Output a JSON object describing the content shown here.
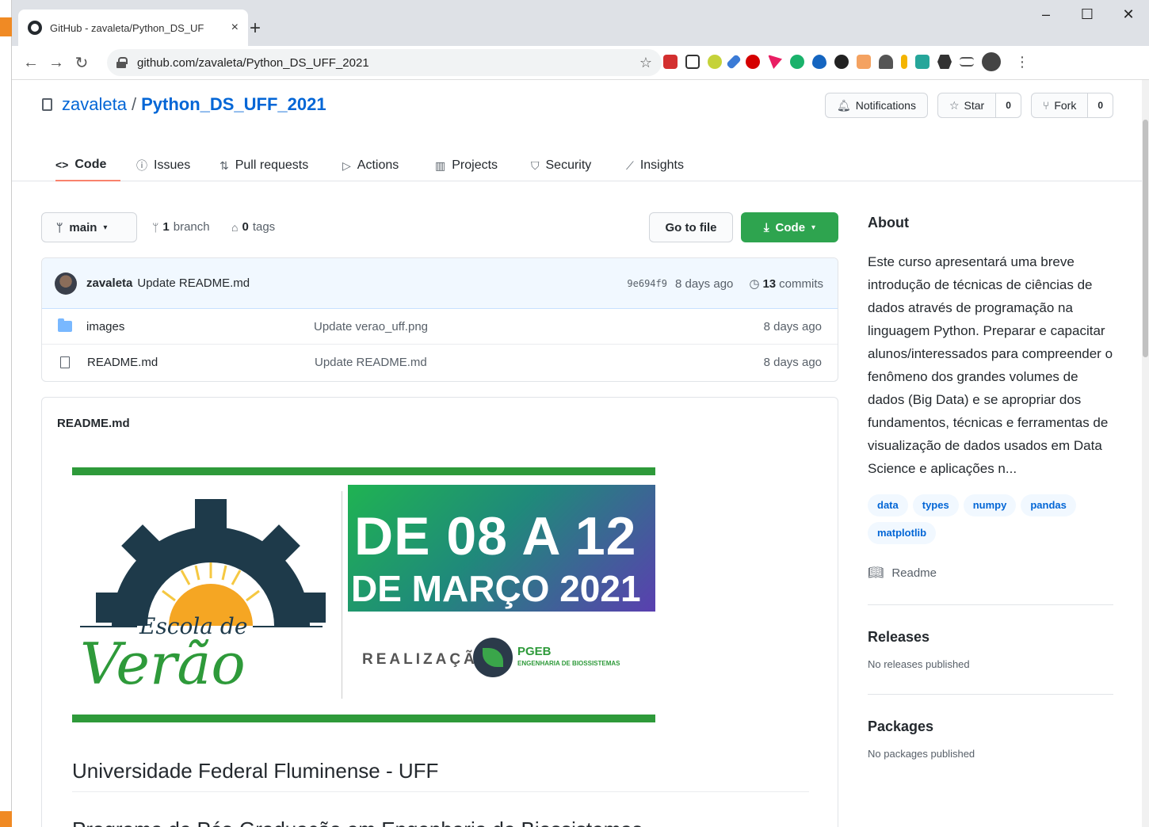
{
  "browser": {
    "tab_title": "GitHub - zavaleta/Python_DS_UF",
    "tab_close": "×",
    "new_tab": "+",
    "url": "github.com/zavaleta/Python_DS_UFF_2021",
    "win_minimize": "–",
    "win_maximize": "☐",
    "win_close": "✕"
  },
  "repo": {
    "owner": "zavaleta",
    "slash": "/",
    "name": "Python_DS_UFF_2021",
    "notifications_label": "Notifications",
    "star_label": "Star",
    "star_count": "0",
    "fork_label": "Fork",
    "fork_count": "0"
  },
  "nav": {
    "tabs": [
      {
        "label": "Code",
        "icon": "<>"
      },
      {
        "label": "Issues",
        "icon": "ⓘ"
      },
      {
        "label": "Pull requests",
        "icon": "⇅"
      },
      {
        "label": "Actions",
        "icon": "▷"
      },
      {
        "label": "Projects",
        "icon": "▥"
      },
      {
        "label": "Security",
        "icon": "⛉"
      },
      {
        "label": "Insights",
        "icon": "⟋"
      }
    ]
  },
  "files_toolbar": {
    "branch": "main",
    "branch_count": "1",
    "branch_word": "branch",
    "tag_count": "0",
    "tag_word": "tags",
    "goto_label": "Go to file",
    "code_label": "Code"
  },
  "commit": {
    "author": "zavaleta",
    "message": "Update README.md",
    "sha": "9e694f9",
    "age": "8 days ago",
    "commit_count": "13",
    "commit_word": "commits"
  },
  "files": [
    {
      "name": "images",
      "type": "folder",
      "commit": "Update verao_uff.png",
      "age": "8 days ago"
    },
    {
      "name": "README.md",
      "type": "file",
      "commit": "Update README.md",
      "age": "8 days ago"
    }
  ],
  "readme": {
    "title": "README.md",
    "banner": {
      "escola": "Escola de",
      "verao": "Verão",
      "date_line1": "DE 08 A 12",
      "date_line2": "DE MARÇO 2021",
      "realizacao": "REALIZAÇÃO",
      "pgeb": "PGEB",
      "pgeb_sub": "ENGENHARIA DE BIOSSISTEMAS"
    },
    "h1": "Universidade Federal Fluminense - UFF",
    "h2": "Programa de Pós-Graduação em Engenharia de Biossistemas"
  },
  "sidebar": {
    "about_title": "About",
    "about_text": "Este curso apresentará uma breve introdução de técnicas de ciências de dados através de programação na linguagem Python. Preparar e capacitar alunos/interessados para compreender o fenômeno dos grandes volumes de dados (Big Data) e se apropriar dos fundamentos, técnicas e ferramentas de visualização de dados usados em Data Science e aplicações n...",
    "topics": [
      "data",
      "types",
      "numpy",
      "pandas",
      "matplotlib"
    ],
    "readme_link": "Readme",
    "releases_title": "Releases",
    "releases_note": "No releases published",
    "packages_title": "Packages",
    "packages_note": "No packages published"
  },
  "colors": {
    "link": "#0366d6",
    "green_button": "#2ea44f",
    "tab_underline": "#f9826c"
  }
}
